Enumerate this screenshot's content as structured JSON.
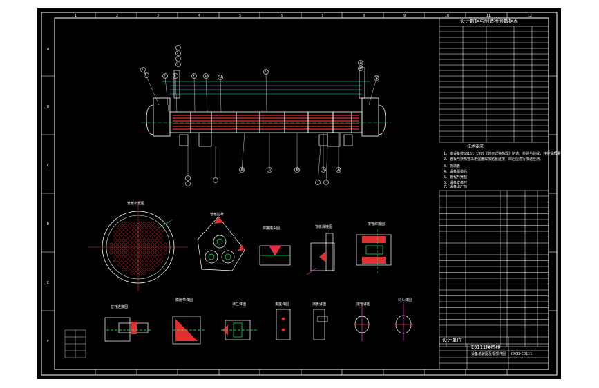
{
  "window": {
    "background": "#ffffff",
    "canvas_color": "#000000",
    "colors": {
      "frame": "#ffffff",
      "accent": "#e03030",
      "dims": "#00ff66",
      "cyan": "#00e5ff",
      "magenta": "#ff33cc",
      "blue": "#3355ff",
      "yellow": "#ffff66"
    }
  },
  "border": {
    "top_zones": [
      "1",
      "2",
      "3",
      "4",
      "5",
      "6",
      "7",
      "8",
      "9",
      "10",
      "11",
      "12"
    ],
    "side_zones": [
      "A",
      "B",
      "C",
      "D",
      "E",
      "F"
    ]
  },
  "drawing": {
    "design_table_title": "设计数据与制造检验数据表",
    "notes_title": "技术要求",
    "notes": [
      "1. 本设备按GB151-1999《管壳式换热器》制造、检验与验收，并接受质量技术监督。",
      "2. 管板与换热管采用强度焊加贴胀连接，焊后应进行渗透检测。",
      "3. 折流板",
      "4. 设备组装后",
      "5. 管程与壳程",
      "6. 设备安装时",
      "7. 设备出厂前"
    ],
    "title_block": {
      "name": "E0111换热器",
      "subtitle": "设备总装图及零部件图",
      "drawing_no": "HX0B-E0111",
      "company": "设计单位"
    },
    "callouts": [
      "1",
      "2",
      "3",
      "4",
      "5",
      "6",
      "7",
      "8",
      "9",
      "10",
      "11",
      "12",
      "13",
      "14",
      "15",
      "16",
      "17",
      "18",
      "19",
      "20"
    ],
    "detail_labels": [
      "管板布置图",
      "管板拉杆",
      "焊接接头图",
      "管板焊接图",
      "接管焊接图",
      "拉杆连接图",
      "膨胀节详图",
      "法兰详图",
      "支座详图",
      "挡板详图",
      "接管详图",
      "封头详图"
    ]
  }
}
